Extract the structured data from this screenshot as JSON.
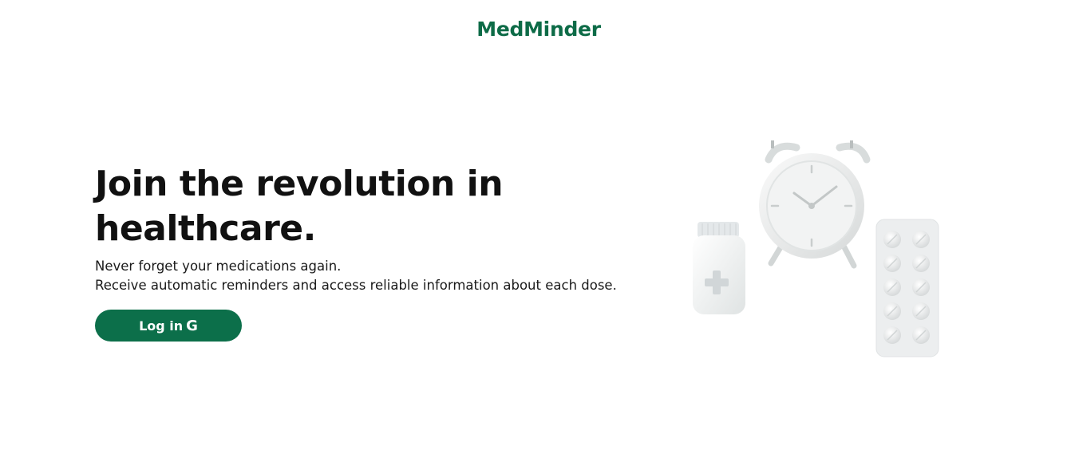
{
  "header": {
    "brand": "MedMinder"
  },
  "hero": {
    "title": "Join the revolution in healthcare.",
    "lines": [
      "Never forget your medications again.",
      "Receive automatic reminders and access reliable information about each dose."
    ],
    "login_label": "Log in",
    "login_icon": "google-icon",
    "login_icon_glyph": "G"
  },
  "colors": {
    "brand": "#0d6b47",
    "button_bg": "#0c6f4a",
    "text": "#111111",
    "background": "#ffffff"
  }
}
